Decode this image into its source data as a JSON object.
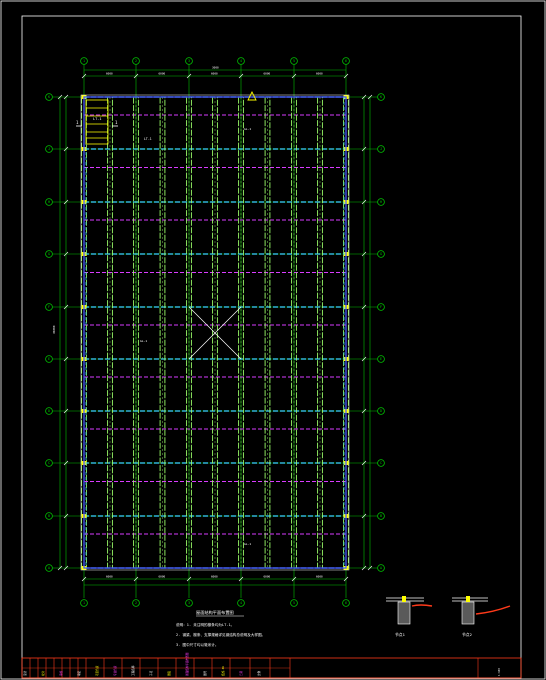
{
  "drawing": {
    "column_grid_labels": [
      "1",
      "2",
      "3",
      "4",
      "5",
      "6"
    ],
    "row_grid_labels": [
      "K",
      "J",
      "H",
      "G",
      "F",
      "E",
      "D",
      "C",
      "B",
      "A"
    ],
    "overall_dimension_top": "3000",
    "overall_dimension_left": "45000",
    "bay_dimension_label": "6000",
    "section_mark": "1",
    "stair_label": "LT-1",
    "purlin_label": "LT-1",
    "beam_label": "GL-1",
    "title": "屋面结构平面布置图",
    "notes": [
      "说明：1. 未注明的檩条均为LT-1。",
      "2. 钢梁、檩条、支撑规格详见钢结构总说明及大样图。",
      "3. 图中尺寸均以毫米计。"
    ],
    "detail_left_label": "节点1",
    "detail_right_label": "节点2"
  },
  "title_block": {
    "cells": [
      "设计",
      "校对",
      "审核",
      "审定",
      "项目负责",
      "专业负责",
      "工程名称",
      "子项",
      "图名",
      "屋面结构平面布置图",
      "图号",
      "结施-06",
      "日期",
      "比例",
      "1:100"
    ]
  },
  "colors": {
    "background": "#000000",
    "border": "#ffffff",
    "grid_axis": "#00c000",
    "beam_fill": "#9cff6a",
    "purlin_cyan": "#3ad8ff",
    "purlin_magenta": "#d93cff",
    "perimeter_blue": "#4a58ff",
    "joint_yellow": "#ffff00",
    "accent_red": "#ff3a1a"
  }
}
